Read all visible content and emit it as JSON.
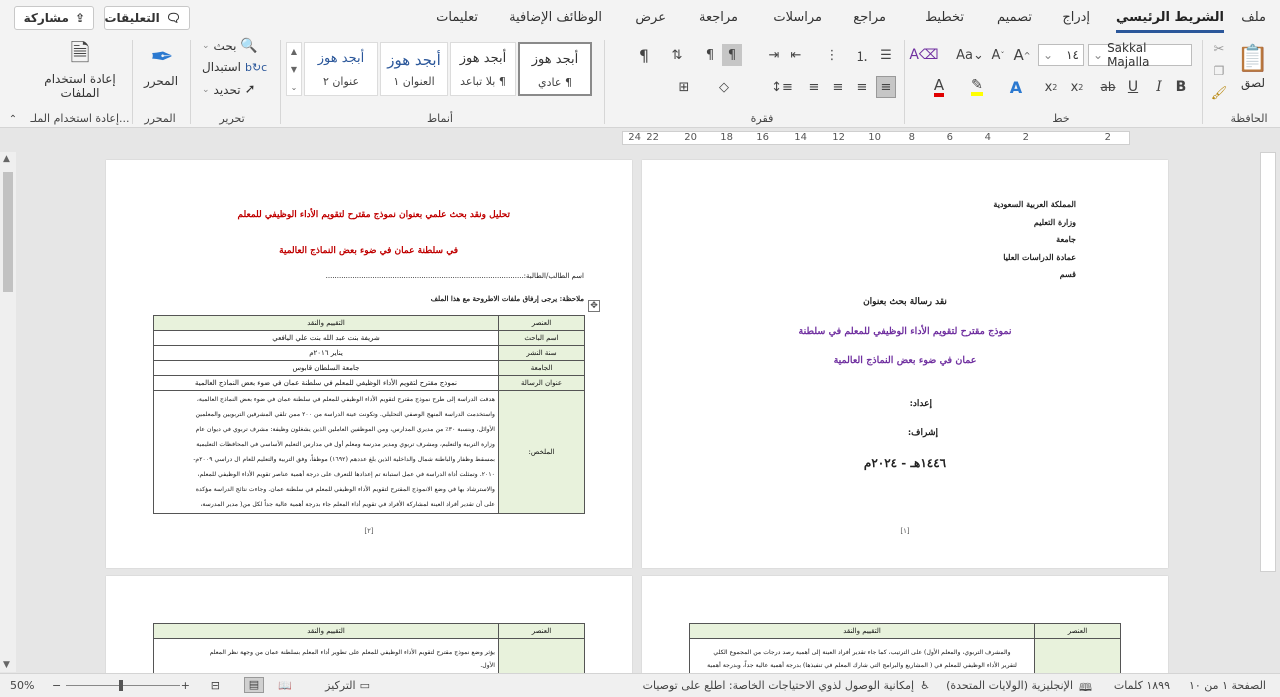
{
  "tabs": [
    "ملف",
    "الشريط الرئيسي",
    "إدراج",
    "تصميم",
    "تخطيط",
    "مراجع",
    "مراسلات",
    "مراجعة",
    "عرض",
    "الوظائف الإضافية",
    "تعليمات"
  ],
  "top_buttons": {
    "share": "مشاركة",
    "comments": "التعليقات"
  },
  "ribbon": {
    "clipboard": {
      "paste": "لصق",
      "label": "الحافظة"
    },
    "font": {
      "name": "Sakkal Majalla",
      "size": "١٤",
      "label": "خط"
    },
    "paragraph": {
      "label": "فقرة"
    },
    "styles": {
      "label": "أنماط",
      "items": [
        {
          "sample": "أبجد هوز",
          "name": "¶ عادي"
        },
        {
          "sample": "أبجد هوز",
          "name": "¶ بلا تباعد"
        },
        {
          "sample": "أبجد هوز",
          "name": "العنوان ١"
        },
        {
          "sample": "أبجد هوز",
          "name": "عنوان ٢"
        }
      ]
    },
    "editing": {
      "find": "بحث",
      "replace": "استبدال",
      "select": "تحديد",
      "label": "تحرير"
    },
    "editor": {
      "button": "المحرر",
      "label": "المحرر"
    },
    "reuse": {
      "button_line1": "إعادة استخدام",
      "button_line2": "الملفات",
      "label": "إعادة استخدام الملـ..."
    }
  },
  "ruler_numbers": [
    "2",
    "2",
    "4",
    "6",
    "8",
    "10",
    "12",
    "14",
    "16",
    "18",
    "20",
    "22",
    "24"
  ],
  "page1": {
    "header": [
      "المملكة العربية السعودية",
      "وزارة التعليم",
      "جامعة",
      "عمادة الدراسات العليا",
      "قسم"
    ],
    "critique_title": "نقد رسالة بحث بعنوان",
    "thesis_title_1": "نموذج مقترح لتقويم الأداء الوظيفي للمعلم في سلطنة",
    "thesis_title_2": "عمان في ضوء بعض النماذج العالمية",
    "prepared": "إعداد:",
    "supervised": "إشراف:",
    "year": "١٤٤٦هـ - ٢٠٢٤م",
    "page_number": "[١]"
  },
  "page2": {
    "title_1": "تحليل ونقد بحث علمي بعنوان نموذج مقترح لتقويم الأداء الوظيفي للمعلم",
    "title_2": "في سلطنة عمان في ضوء بعض النماذج العالمية",
    "student": "اسم الطالب/الطالبة:.........................................................................................",
    "note": "ملاحظة: يرجى إرفاق ملفات الاطروحة مع هذا الملف",
    "table": {
      "headers": [
        "العنصر",
        "التقييم والنقد"
      ],
      "rows": [
        [
          "اسم الباحث",
          "شريفة بنت عبد الله بنت علي اليافعي"
        ],
        [
          "سنة النشر",
          "يناير ٢٠١٦م"
        ],
        [
          "الجامعة",
          "جامعة السلطان قابوس"
        ],
        [
          "عنوان الرسالة",
          "نموذج مقترح لتقويم الأداء الوظيفي للمعلم في سلطنة عمان في ضوء بعض النماذج العالمية"
        ]
      ],
      "summary_label": "الملخص:",
      "summary_lines": [
        "هدفت الدراسة إلى طرح نموذج مقترح لتقويم الأداء الوظيفي للمعلم في سلطنة عمان في ضوء بعض النماذج العالمية،",
        "واستخدمت الدراسة المنهج الوصفي التحليلي. وتكونت عينة الدراسة من ٢٠٠ ممن تلقي المشرفين التربويين والمعلمين",
        "الأوائل، وبنسبة ٣٠٪ من مديري المدارس، ومن الموظفين العاملين الذين يشغلون وظيفة: مشرف تربوي في ديوان عام",
        "وزارة التربية والتعليم، ومشرف تربوي ومدير مدرسة ومعلم أول في مدارس التعليم الأساسي في المحافظات التعليمية",
        "بمسقط وظفار والباطنة شمال والداخلية الذين بلغ عددهم (١٦٩٢) موظفاً، وفق التربية والتعليم للعام ال دراسي ٢٠٠٩م-",
        "٢٠١٠. وتمثلت أداة الدراسة في عمل استبانة تم إعدادها للتعرف على درجة أهمية عناصر تقويم الأداء الوظيفي للمعلم،",
        "والاسترشاد بها في وضع الانموذج المقترح لتقويم الأداء الوظيفي للمعلم في سلطنة عمان. وجاءت نتائج الدراسة مؤكدة",
        "على أن تقدير أفراد العينة لمشاركة الأفراد في تقويم أداء المعلم جاء بدرجة أهمية عالية جداً لكل من( مدير المدرسة،"
      ]
    },
    "page_number": "[٢]"
  },
  "page3": {
    "table_headers": [
      "العنصر",
      "التقييم والنقد"
    ],
    "lines": [
      "يؤثر وضع نموذج مقترح لتقويم الأداء الوظيفي للمعلم على تطوير أداء المعلم بسلطنة عمان من وجهة نظر المعلم",
      "الأول."
    ]
  },
  "page4": {
    "table_headers": [
      "العنصر",
      "التقييم والنقد"
    ],
    "lines": [
      "والمشرف التربوي، والمعلم الأول) على الترتيب، كما جاء تقدير أفراد العينة إلى أهمية رصد درجات من المجموع الكلي",
      "لتقرير الأداء الوظيفي للمعلم في ( المشاريع والبرامج التي شارك المعلم في تنفيذها) بدرجة أهمية عالية جداً، وبدرجة أهمية"
    ]
  },
  "status": {
    "page": "الصفحة ١ من ١٠",
    "words": "١٨٩٩ كلمات",
    "language": "الإنجليزية (الولايات المتحدة)",
    "accessibility": "إمكانية الوصول لذوي الاحتياجات الخاصة: اطلع على توصيات",
    "focus": "التركيز",
    "zoom": "50%"
  },
  "colors": {
    "accent": "#2b579a",
    "red_title": "#c00000",
    "purple_title": "#7030a0",
    "table_fill": "#e8f2dc"
  }
}
